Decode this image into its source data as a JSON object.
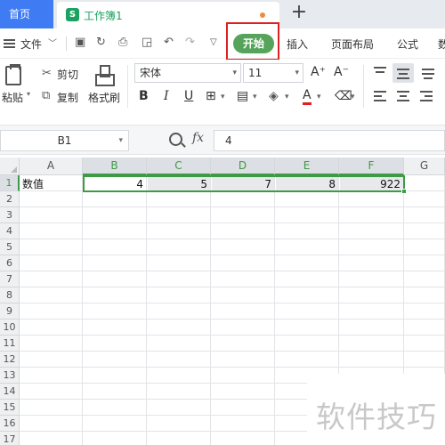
{
  "tabs": {
    "home": "首页",
    "document": "工作簿1",
    "doc_icon_letter": "S",
    "new_tab": "+"
  },
  "menu": {
    "file": "文件",
    "items": [
      "开始",
      "插入",
      "页面布局",
      "公式",
      "数"
    ],
    "active": "开始"
  },
  "ribbon": {
    "paste": "粘贴",
    "cut": "剪切",
    "copy": "复制",
    "format_painter": "格式刷",
    "font_name": "宋体",
    "font_size": "11",
    "bold": "B",
    "italic": "I",
    "underline": "U",
    "font_color_letter": "A",
    "grow_font": "A⁺",
    "shrink_font": "A⁻"
  },
  "formula_bar": {
    "name_box": "B1",
    "fx": "fx",
    "value": "4"
  },
  "grid": {
    "columns": [
      "A",
      "B",
      "C",
      "D",
      "E",
      "F",
      "G"
    ],
    "selected_columns": [
      "B",
      "C",
      "D",
      "E",
      "F"
    ],
    "rows": [
      "1",
      "2",
      "3",
      "4",
      "5",
      "6",
      "7",
      "8",
      "9",
      "10",
      "11",
      "12",
      "13",
      "14",
      "15",
      "16",
      "17"
    ],
    "row1": {
      "A": "数值",
      "B": "4",
      "C": "5",
      "D": "7",
      "E": "8",
      "F": "922"
    }
  },
  "watermark": "软件技巧",
  "colors": {
    "home_tab": "#3f7cf4",
    "start_button": "#56a45b",
    "highlight_box": "#e02020",
    "selection": "#3f9a45",
    "doc_icon": "#1aa260"
  }
}
